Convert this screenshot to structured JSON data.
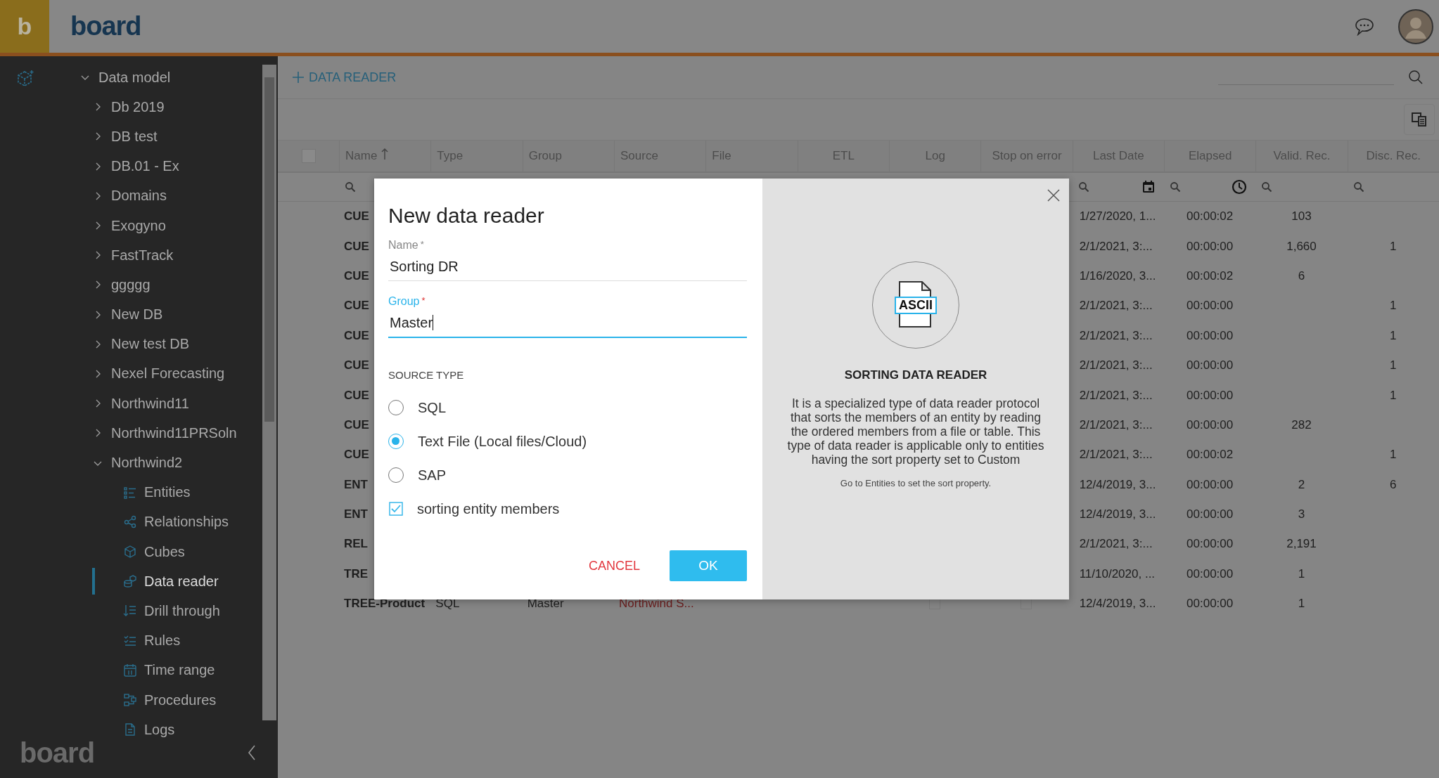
{
  "header": {
    "logo_mark": "b",
    "wordmark": "board"
  },
  "sidebar": {
    "tree": [
      {
        "label": "Data model",
        "expanded": true,
        "children": [
          {
            "label": "Db 2019",
            "expanded": false
          },
          {
            "label": "DB test",
            "expanded": false
          },
          {
            "label": "DB.01 - Ex",
            "expanded": false
          },
          {
            "label": "Domains",
            "expanded": false
          },
          {
            "label": "Exogyno",
            "expanded": false
          },
          {
            "label": "FastTrack",
            "expanded": false
          },
          {
            "label": "ggggg",
            "expanded": false
          },
          {
            "label": "New DB",
            "expanded": false
          },
          {
            "label": "New test DB",
            "expanded": false
          },
          {
            "label": "Nexel Forecasting",
            "expanded": false
          },
          {
            "label": "Northwind11",
            "expanded": false
          },
          {
            "label": "Northwind11PRSoln",
            "expanded": false
          },
          {
            "label": "Northwind2",
            "expanded": true,
            "children": [
              {
                "label": "Entities",
                "kind": "entities",
                "selected": false
              },
              {
                "label": "Relationships",
                "kind": "relationships",
                "selected": false
              },
              {
                "label": "Cubes",
                "kind": "cubes",
                "selected": false
              },
              {
                "label": "Data reader",
                "kind": "datareader",
                "selected": true
              },
              {
                "label": "Drill through",
                "kind": "drillthrough",
                "selected": false
              },
              {
                "label": "Rules",
                "kind": "rules",
                "selected": false
              },
              {
                "label": "Time range",
                "kind": "timerange",
                "selected": false
              },
              {
                "label": "Procedures",
                "kind": "procedures",
                "selected": false
              },
              {
                "label": "Logs",
                "kind": "logs",
                "selected": false
              }
            ]
          }
        ]
      }
    ],
    "footer_logo": "board"
  },
  "toolbar": {
    "add_label": "DATA READER"
  },
  "table": {
    "columns": [
      {
        "label": "Name",
        "sorted": true,
        "searchable": true
      },
      {
        "label": "Type",
        "sorted": false
      },
      {
        "label": "Group",
        "sorted": false
      },
      {
        "label": "Source",
        "sorted": false
      },
      {
        "label": "File",
        "sorted": false
      },
      {
        "label": "ETL",
        "sorted": false
      },
      {
        "label": "Log",
        "sorted": false
      },
      {
        "label": "Stop on error",
        "sorted": false
      },
      {
        "label": "Last Date",
        "sorted": false,
        "searchable": true,
        "calendar": true
      },
      {
        "label": "Elapsed",
        "sorted": false,
        "searchable": true,
        "clock": true
      },
      {
        "label": "Valid. Rec.",
        "sorted": false,
        "searchable": true
      },
      {
        "label": "Disc. Rec.",
        "sorted": false,
        "searchable": true
      }
    ],
    "all_selected": false,
    "rows": [
      {
        "name": "CUE",
        "last_date": "1/27/2020, 1...",
        "elapsed": "00:00:02",
        "valid_rec": "103"
      },
      {
        "name": "CUE",
        "last_date": "2/1/2021, 3:...",
        "elapsed": "00:00:00",
        "valid_rec": "1,660",
        "disc_rec": "1"
      },
      {
        "name": "CUE",
        "last_date": "1/16/2020, 3...",
        "elapsed": "00:00:02",
        "valid_rec": "6"
      },
      {
        "name": "CUE",
        "last_date": "2/1/2021, 3:...",
        "elapsed": "00:00:00",
        "disc_rec": "1"
      },
      {
        "name": "CUE",
        "last_date": "2/1/2021, 3:...",
        "elapsed": "00:00:00",
        "disc_rec": "1"
      },
      {
        "name": "CUE",
        "last_date": "2/1/2021, 3:...",
        "elapsed": "00:00:00",
        "disc_rec": "1"
      },
      {
        "name": "CUE",
        "last_date": "2/1/2021, 3:...",
        "elapsed": "00:00:00",
        "disc_rec": "1"
      },
      {
        "name": "CUE",
        "last_date": "2/1/2021, 3:...",
        "elapsed": "00:00:00",
        "valid_rec": "282"
      },
      {
        "name": "CUE",
        "last_date": "2/1/2021, 3:...",
        "elapsed": "00:00:02",
        "disc_rec": "1"
      },
      {
        "name": "ENT",
        "last_date": "12/4/2019, 3...",
        "elapsed": "00:00:00",
        "valid_rec": "2",
        "disc_rec": "6"
      },
      {
        "name": "ENT",
        "last_date": "12/4/2019, 3...",
        "elapsed": "00:00:00",
        "valid_rec": "3"
      },
      {
        "name": "REL",
        "last_date": "2/1/2021, 3:...",
        "elapsed": "00:00:00",
        "valid_rec": "2,191"
      },
      {
        "name": "TRE",
        "last_date": "11/10/2020, ...",
        "elapsed": "00:00:00",
        "valid_rec": "1"
      },
      {
        "name": "TREE-Product",
        "type": "SQL",
        "group": "Master",
        "source": "Northwind S...",
        "log_checked": false,
        "stop_checked": false,
        "last_date": "12/4/2019, 3...",
        "elapsed": "00:00:00",
        "valid_rec": "1"
      }
    ]
  },
  "dialog": {
    "title": "New data reader",
    "fields": [
      {
        "label": "Name",
        "required_mark": "*",
        "value": "Sorting DR",
        "focused": false
      },
      {
        "label": "Group",
        "required_mark": "*",
        "value": "Master",
        "focused": true
      }
    ],
    "section_label": "SOURCE TYPE",
    "source_types": [
      {
        "label": "SQL",
        "selected": false
      },
      {
        "label": "Text File (Local files/Cloud)",
        "selected": true
      },
      {
        "label": "SAP",
        "selected": false
      }
    ],
    "option": {
      "label": "sorting entity members",
      "checked": true
    },
    "buttons": [
      {
        "label": "CANCEL",
        "kind": "text"
      },
      {
        "label": "OK",
        "kind": "primary"
      }
    ],
    "info": {
      "icon_label": "ASCII",
      "title": "SORTING DATA READER",
      "description": "It is a specialized type of data reader protocol that sorts the members of an entity by reading the ordered members from a file or table. This type of data reader is applicable only to entities having the sort property set to Custom",
      "note": "Go to Entities to set the sort property."
    }
  }
}
